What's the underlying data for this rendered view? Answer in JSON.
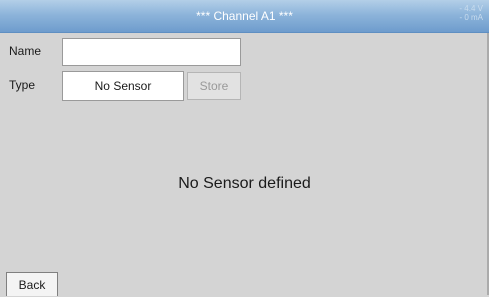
{
  "header": {
    "title": "*** Channel A1 ***",
    "corner_line1": "- 4.4 V",
    "corner_line2": "- 0 mA"
  },
  "form": {
    "name_label": "Name",
    "name_value": "",
    "type_label": "Type",
    "type_value": "No Sensor",
    "store_label": "Store"
  },
  "main": {
    "message": "No Sensor defined"
  },
  "footer": {
    "back_label": "Back"
  },
  "colors": {
    "header_blue": "#8db4da",
    "background": "#d4d4d4",
    "disabled_text": "#9a9a9a"
  }
}
